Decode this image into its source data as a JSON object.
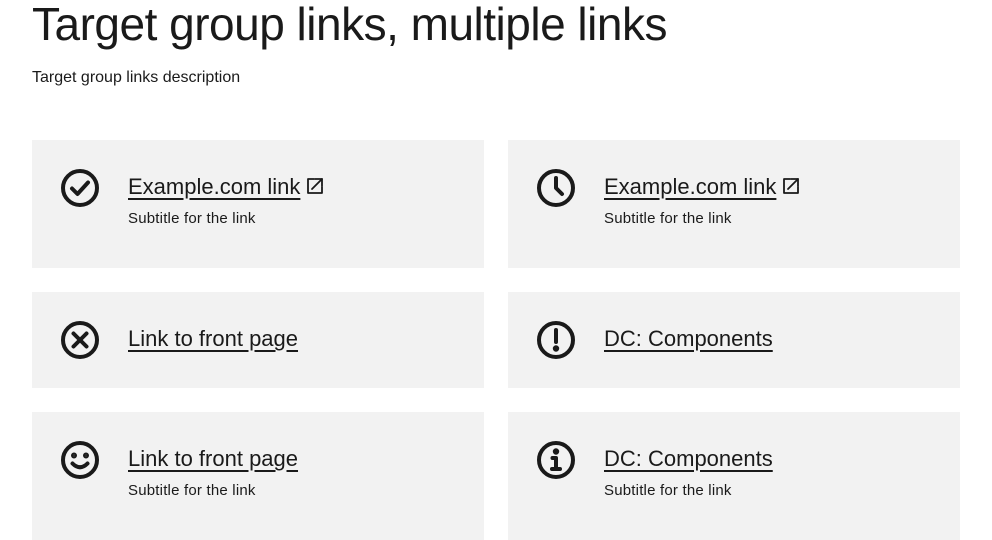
{
  "header": {
    "title": "Target group links, multiple links",
    "description": "Target group links description"
  },
  "cards": [
    {
      "icon": "check-circle-icon",
      "title": "Example.com link",
      "external": true,
      "subtitle": "Subtitle for the link"
    },
    {
      "icon": "clock-icon",
      "title": "Example.com link",
      "external": true,
      "subtitle": "Subtitle for the link"
    },
    {
      "icon": "x-circle-icon",
      "title": "Link to front page",
      "external": false,
      "subtitle": ""
    },
    {
      "icon": "exclamation-circle-icon",
      "title": "DC: Components",
      "external": false,
      "subtitle": ""
    },
    {
      "icon": "smiley-icon",
      "title": "Link to front page",
      "external": false,
      "subtitle": "Subtitle for the link"
    },
    {
      "icon": "info-circle-icon",
      "title": "DC: Components",
      "external": false,
      "subtitle": "Subtitle for the link"
    }
  ],
  "colors": {
    "card_background": "#f2f2f2",
    "text": "#1a1a1a"
  }
}
